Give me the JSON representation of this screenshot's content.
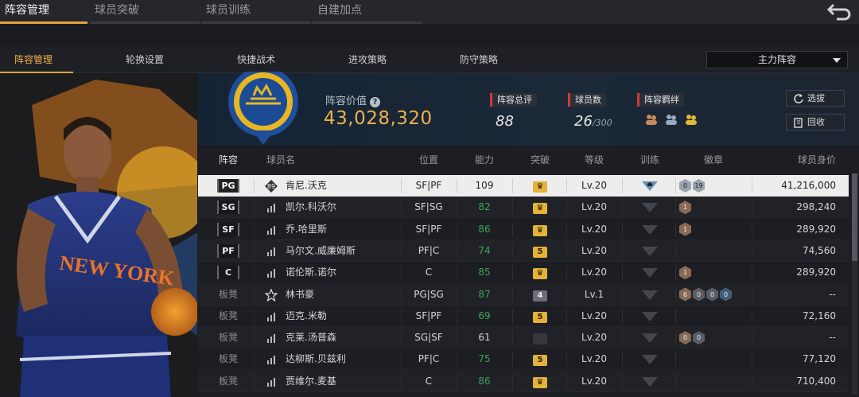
{
  "top_tabs": [
    {
      "label": "阵容管理",
      "active": true
    },
    {
      "label": "球员突破",
      "active": false
    },
    {
      "label": "球员训练",
      "active": false
    },
    {
      "label": "自建加点",
      "active": false
    }
  ],
  "sub_tabs": [
    {
      "label": "阵容管理",
      "active": true
    },
    {
      "label": "轮换设置",
      "active": false
    },
    {
      "label": "快捷战术",
      "active": false
    },
    {
      "label": "进攻策略",
      "active": false
    },
    {
      "label": "防守策略",
      "active": false
    }
  ],
  "lineup_select": {
    "value": "主力阵容"
  },
  "header": {
    "value_label": "阵容价值",
    "value": "43,028,320",
    "rating_label": "阵容总评",
    "rating": "88",
    "count_label": "球员数",
    "count": "26",
    "count_max": "/300",
    "bond_label": "阵容羁绊",
    "pick_button": "选拔",
    "recycle_button": "回收"
  },
  "table": {
    "headers": [
      "阵容",
      "球员名",
      "位置",
      "能力",
      "突破",
      "等级",
      "训练",
      "徽章",
      "球员身价"
    ],
    "rows": [
      {
        "slot": "PG",
        "bench": false,
        "icon": "rating",
        "icon_text": "89",
        "name": "肯尼.沃克",
        "position": "SF|PF",
        "ability": "109",
        "ability_green": false,
        "break": "crown",
        "level": "Lv.20",
        "train": "active",
        "badges": [
          {
            "t": "0",
            "c": "silver"
          },
          {
            "t": "19",
            "c": "silver"
          }
        ],
        "price": "41,216,000"
      },
      {
        "slot": "SG",
        "bench": false,
        "icon": "bars",
        "name": "凯尔.科沃尔",
        "position": "SF|SG",
        "ability": "82",
        "ability_green": true,
        "break": "crown",
        "level": "Lv.20",
        "train": "idle",
        "badges": [
          {
            "t": "1",
            "c": "bronze"
          }
        ],
        "price": "298,240"
      },
      {
        "slot": "SF",
        "bench": false,
        "icon": "bars",
        "name": "乔.哈里斯",
        "position": "SF|PF",
        "ability": "86",
        "ability_green": true,
        "break": "crown",
        "level": "Lv.20",
        "train": "idle",
        "badges": [
          {
            "t": "1",
            "c": "bronze"
          }
        ],
        "price": "289,920"
      },
      {
        "slot": "PF",
        "bench": false,
        "icon": "bars",
        "name": "马尔文.威廉姆斯",
        "position": "PF|C",
        "ability": "74",
        "ability_green": true,
        "break": "5",
        "level": "Lv.20",
        "train": "idle",
        "badges": [],
        "price": "74,560"
      },
      {
        "slot": "C",
        "bench": false,
        "icon": "bars",
        "name": "诺伦斯.诺尔",
        "position": "C",
        "ability": "85",
        "ability_green": true,
        "break": "crown",
        "level": "Lv.20",
        "train": "idle",
        "badges": [
          {
            "t": "1",
            "c": "bronze"
          }
        ],
        "price": "289,920"
      },
      {
        "slot": "板凳",
        "bench": true,
        "icon": "star",
        "name": "林书豪",
        "position": "PG|SG",
        "ability": "87",
        "ability_green": true,
        "break": "4",
        "level": "Lv.1",
        "train": "idle",
        "badges": [
          {
            "t": "6",
            "c": "bronze"
          },
          {
            "t": "0",
            "c": "dark"
          },
          {
            "t": "0",
            "c": "dark"
          },
          {
            "t": "0",
            "c": "blue"
          }
        ],
        "price": "--"
      },
      {
        "slot": "板凳",
        "bench": true,
        "icon": "bars",
        "name": "迈克.米勒",
        "position": "SF|PF",
        "ability": "69",
        "ability_green": true,
        "break": "5",
        "level": "Lv.20",
        "train": "idle",
        "badges": [],
        "price": "72,160"
      },
      {
        "slot": "板凳",
        "bench": true,
        "icon": "bars",
        "name": "克莱.汤普森",
        "position": "SG|SF",
        "ability": "61",
        "ability_green": false,
        "break": "none",
        "level": "Lv.20",
        "train": "idle",
        "badges": [
          {
            "t": "0",
            "c": "bronze"
          },
          {
            "t": "0",
            "c": "dark"
          }
        ],
        "price": "--"
      },
      {
        "slot": "板凳",
        "bench": true,
        "icon": "bars",
        "name": "达柳斯.贝兹利",
        "position": "PF|C",
        "ability": "75",
        "ability_green": true,
        "break": "5",
        "level": "Lv.20",
        "train": "idle",
        "badges": [],
        "price": "77,120"
      },
      {
        "slot": "板凳",
        "bench": true,
        "icon": "bars",
        "name": "贾维尔.麦基",
        "position": "C",
        "ability": "86",
        "ability_green": true,
        "break": "crown",
        "level": "Lv.20",
        "train": "idle",
        "badges": [],
        "price": "710,400"
      }
    ]
  },
  "colors": {
    "accent": "#e0a53a",
    "value": "#f0b14a",
    "green": "#3aa55a",
    "tag_red": "#d03a3a"
  },
  "icons": {
    "back": "back-arrow-icon",
    "help": "help-icon",
    "pick": "refresh-icon",
    "recycle": "recycle-icon",
    "caret": "chevron-down-icon"
  }
}
